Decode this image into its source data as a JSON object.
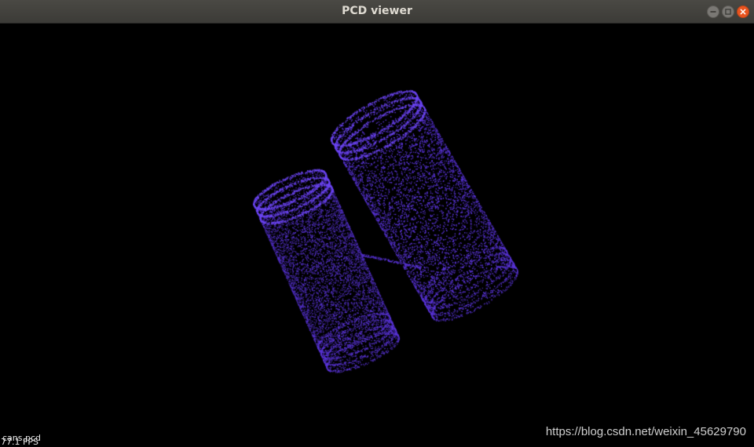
{
  "window": {
    "title": "PCD viewer"
  },
  "window_controls": {
    "minimize_icon": "minimize-icon",
    "maximize_icon": "maximize-icon",
    "close_icon": "close-icon"
  },
  "viewer": {
    "background_color": "#000000",
    "point_color": "#5a35d8",
    "cloud_label": "cans.pcd",
    "fps_text": "77.1 FPS"
  },
  "watermark": {
    "text": "https://blog.csdn.net/weixin_45629790"
  }
}
